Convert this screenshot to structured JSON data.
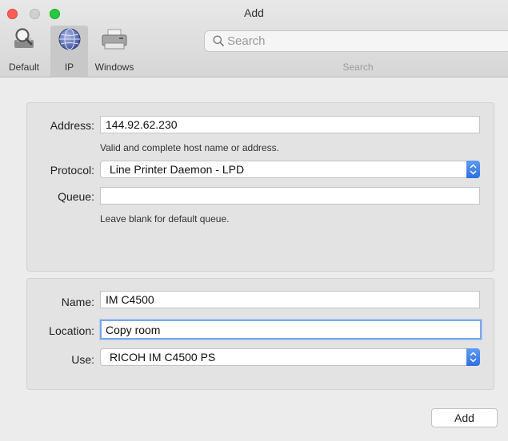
{
  "window": {
    "title": "Add"
  },
  "toolbar": {
    "items": [
      {
        "label": "Default",
        "icon": "default-printers-icon",
        "selected": false
      },
      {
        "label": "IP",
        "icon": "globe-network-icon",
        "selected": true
      },
      {
        "label": "Windows",
        "icon": "windows-printer-icon",
        "selected": false
      }
    ],
    "search": {
      "placeholder": "Search",
      "value": "",
      "caption": "Search"
    }
  },
  "ip_form": {
    "address_label": "Address:",
    "address_value": "144.92.62.230",
    "address_hint": "Valid and complete host name or address.",
    "protocol_label": "Protocol:",
    "protocol_value": "Line Printer Daemon - LPD",
    "queue_label": "Queue:",
    "queue_value": "",
    "queue_hint": "Leave blank for default queue."
  },
  "printer_form": {
    "name_label": "Name:",
    "name_value": "IM C4500",
    "location_label": "Location:",
    "location_value": "Copy room",
    "use_label": "Use:",
    "use_value": "RICOH IM C4500 PS"
  },
  "actions": {
    "add_label": "Add"
  },
  "colors": {
    "accent": "#2e6fe0",
    "focus_ring": "#7aa7e9",
    "close": "#fd5f57",
    "zoom": "#27c93f"
  }
}
